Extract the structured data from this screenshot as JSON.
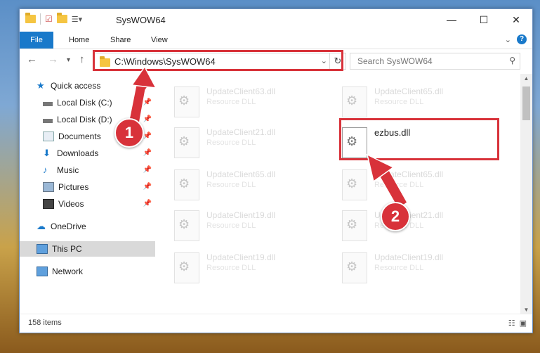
{
  "window": {
    "title": "SysWOW64",
    "controls": {
      "minimize": "—",
      "maximize": "☐",
      "close": "✕"
    }
  },
  "ribbon": {
    "tabs": [
      "File",
      "Home",
      "Share",
      "View"
    ]
  },
  "address": {
    "path": "C:\\Windows\\SysWOW64",
    "search_placeholder": "Search SysWOW64"
  },
  "sidebar": {
    "items": [
      {
        "label": "Quick access",
        "icon": "star-icon"
      },
      {
        "label": "Local Disk (C:)",
        "icon": "drive-icon"
      },
      {
        "label": "Local Disk (D:)",
        "icon": "drive-icon"
      },
      {
        "label": "Documents",
        "icon": "documents-icon"
      },
      {
        "label": "Downloads",
        "icon": "download-icon"
      },
      {
        "label": "Music",
        "icon": "music-icon"
      },
      {
        "label": "Pictures",
        "icon": "pictures-icon"
      },
      {
        "label": "Videos",
        "icon": "videos-icon"
      },
      {
        "label": "OneDrive",
        "icon": "cloud-icon"
      },
      {
        "label": "This PC",
        "icon": "computer-icon"
      },
      {
        "label": "Network",
        "icon": "network-icon"
      }
    ]
  },
  "files": [
    {
      "name": "UpdateClient63.dll",
      "type": "Resource DLL"
    },
    {
      "name": "UpdateClient65.dll",
      "type": "Resource DLL"
    },
    {
      "name": "UpdateClient21.dll",
      "type": "Resource DLL"
    },
    {
      "name": "ezbus.dll",
      "type": ""
    },
    {
      "name": "UpdateClient65.dll",
      "type": "Resource DLL"
    },
    {
      "name": "UpdateClient65.dll",
      "type": "Resource DLL"
    },
    {
      "name": "UpdateClient19.dll",
      "type": "Resource DLL"
    },
    {
      "name": "UpdateClient21.dll",
      "type": "Resource DLL"
    },
    {
      "name": "UpdateClient19.dll",
      "type": "Resource DLL"
    },
    {
      "name": "UpdateClient19.dll",
      "type": "Resource DLL"
    }
  ],
  "status": {
    "item_count": "158 items"
  },
  "callouts": {
    "one": "1",
    "two": "2"
  },
  "colors": {
    "accent": "#1979ca",
    "highlight": "#d8323a"
  }
}
